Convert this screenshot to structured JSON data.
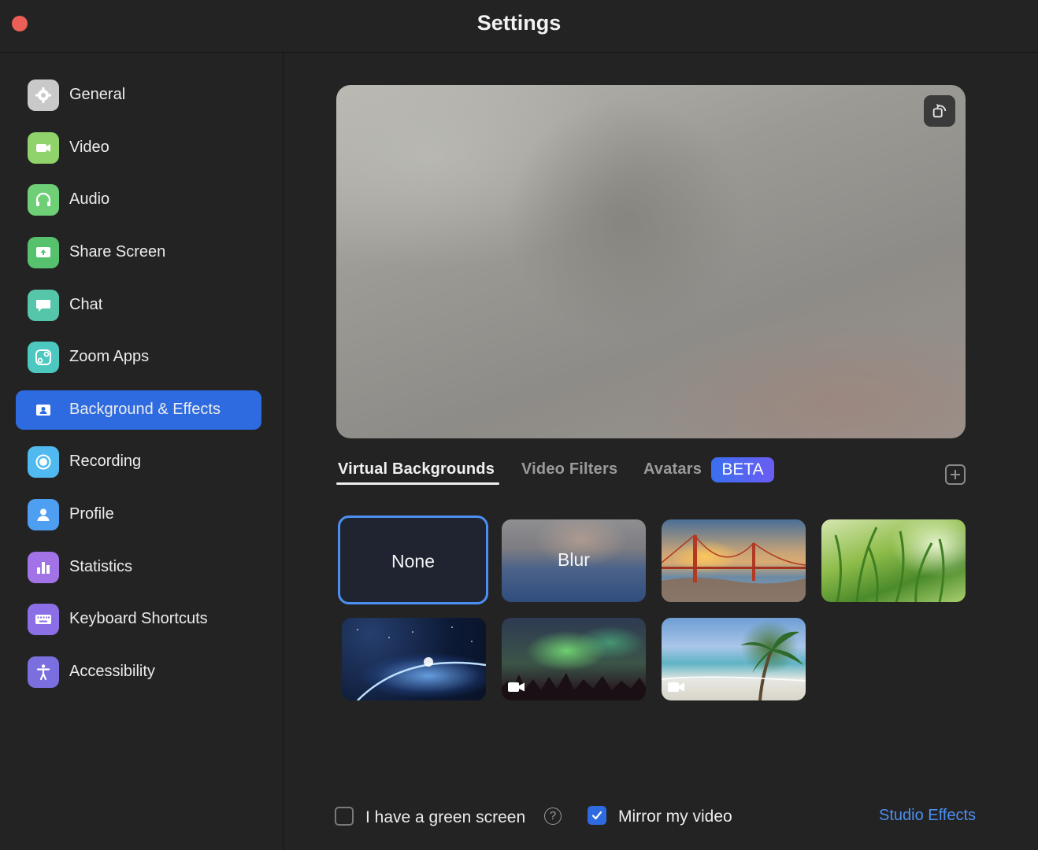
{
  "window": {
    "title": "Settings"
  },
  "sidebar": {
    "items": [
      {
        "label": "General",
        "icon": "gear-icon",
        "color": "#c9c9c9",
        "active": false
      },
      {
        "label": "Video",
        "icon": "video-camera-icon",
        "color": "#8fd36a",
        "active": false
      },
      {
        "label": "Audio",
        "icon": "headphones-icon",
        "color": "#6fcf76",
        "active": false
      },
      {
        "label": "Share Screen",
        "icon": "share-screen-icon",
        "color": "#56c26e",
        "active": false
      },
      {
        "label": "Chat",
        "icon": "chat-bubble-icon",
        "color": "#55c6a9",
        "active": false
      },
      {
        "label": "Zoom Apps",
        "icon": "apps-icon",
        "color": "#4cc8c0",
        "active": false
      },
      {
        "label": "Background & Effects",
        "icon": "person-card-icon",
        "color": "#2e6be0",
        "active": true
      },
      {
        "label": "Recording",
        "icon": "record-icon",
        "color": "#4fb9f0",
        "active": false
      },
      {
        "label": "Profile",
        "icon": "profile-icon",
        "color": "#4e9ff2",
        "active": false
      },
      {
        "label": "Statistics",
        "icon": "bar-chart-icon",
        "color": "#a273e6",
        "active": false
      },
      {
        "label": "Keyboard Shortcuts",
        "icon": "keyboard-icon",
        "color": "#8a6fe6",
        "active": false
      },
      {
        "label": "Accessibility",
        "icon": "accessibility-icon",
        "color": "#7b6fe0",
        "active": false
      }
    ]
  },
  "main": {
    "tabs": [
      {
        "label": "Virtual Backgrounds",
        "active": true
      },
      {
        "label": "Video Filters",
        "active": false
      },
      {
        "label": "Avatars",
        "active": false
      }
    ],
    "beta_badge": "BETA",
    "backgrounds": [
      {
        "label": "None",
        "selected": true
      },
      {
        "label": "Blur",
        "selected": false
      },
      {
        "label": "",
        "selected": false
      },
      {
        "label": "",
        "selected": false
      },
      {
        "label": "",
        "selected": false
      },
      {
        "label": "",
        "selected": false
      },
      {
        "label": "",
        "selected": false
      }
    ],
    "green_screen_label": "I have a green screen",
    "green_screen_checked": false,
    "mirror_label": "Mirror my video",
    "mirror_checked": true,
    "help_glyph": "?",
    "studio_effects_label": "Studio Effects"
  },
  "colors": {
    "accent": "#2e6be0",
    "link": "#4d8ff1",
    "close": "#ec5f57"
  }
}
